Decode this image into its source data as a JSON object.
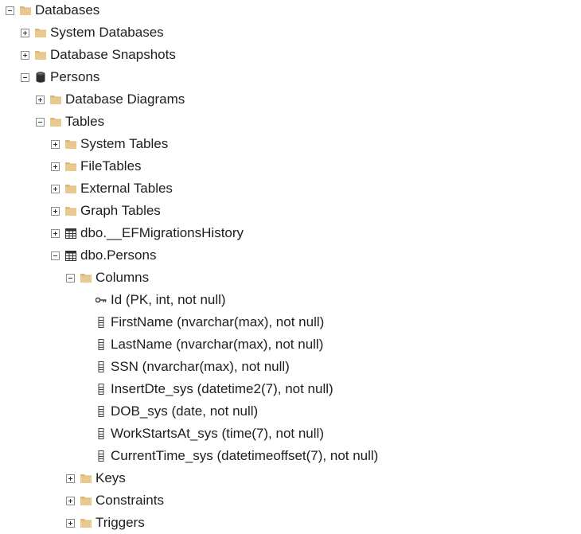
{
  "tree": {
    "databases": "Databases",
    "system_databases": "System Databases",
    "database_snapshots": "Database Snapshots",
    "persons_db": "Persons",
    "database_diagrams": "Database Diagrams",
    "tables": "Tables",
    "system_tables": "System Tables",
    "filetables": "FileTables",
    "external_tables": "External Tables",
    "graph_tables": "Graph Tables",
    "ef_migrations": "dbo.__EFMigrationsHistory",
    "dbo_persons": "dbo.Persons",
    "columns": "Columns",
    "columns_list": [
      "Id (PK, int, not null)",
      "FirstName (nvarchar(max), not null)",
      "LastName (nvarchar(max), not null)",
      "SSN (nvarchar(max), not null)",
      "InsertDte_sys (datetime2(7), not null)",
      "DOB_sys (date, not null)",
      "WorkStartsAt_sys (time(7), not null)",
      "CurrentTime_sys (datetimeoffset(7), not null)"
    ],
    "keys": "Keys",
    "constraints": "Constraints",
    "triggers": "Triggers"
  },
  "icons": {
    "folder": "folder-icon",
    "database": "database-icon",
    "table": "table-icon",
    "key": "key-icon",
    "column": "column-icon"
  },
  "colors": {
    "folder": "#dcb67a",
    "folder_dark": "#c9a15e",
    "database": "#2f2f2f",
    "text": "#1e1e1e"
  }
}
